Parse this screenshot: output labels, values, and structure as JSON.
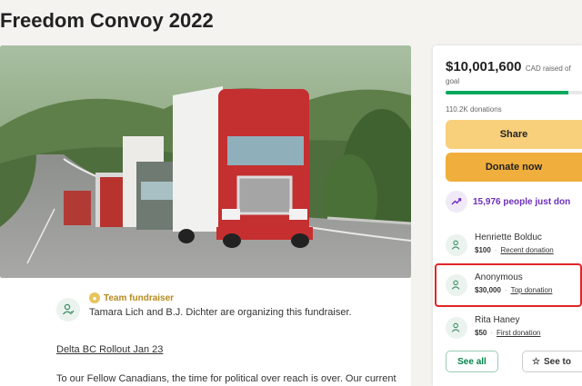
{
  "page": {
    "title": "Freedom Convoy 2022"
  },
  "organizer": {
    "badge": "Team fundraiser",
    "text": "Tamara Lich and B.J. Dichter are organizing this fundraiser."
  },
  "story": {
    "heading": "Delta BC Rollout Jan 23",
    "body": "To our Fellow Canadians, the time for political over reach is over.  Our current"
  },
  "donation_panel": {
    "raised_amount": "$10,001,600",
    "raised_rest": "CAD raised of",
    "goal_label": "goal",
    "progress_fraction": 0.9,
    "donation_count": "110.2K donations",
    "share_label": "Share",
    "donate_label": "Donate now",
    "just_donated": "15,976 people just don",
    "donors": [
      {
        "name": "Henriette Bolduc",
        "amount": "$100",
        "tag": "Recent donation"
      },
      {
        "name": "Anonymous",
        "amount": "$30,000",
        "tag": "Top donation"
      },
      {
        "name": "Rita Haney",
        "amount": "$50",
        "tag": "First donation"
      }
    ],
    "see_all_label": "See all",
    "see_top_label": "See to"
  },
  "colors": {
    "accent_green": "#02a95c",
    "share_yellow": "#f8cf7b",
    "donate_orange": "#f0ae3c",
    "purple_text": "#6c2eb9",
    "highlight_red": "#e02626"
  },
  "icons": {
    "organizer": "person-heart-icon",
    "team": "team-icon",
    "trend": "trending-up-icon",
    "donor": "person-heart-icon",
    "star": "star-icon"
  }
}
